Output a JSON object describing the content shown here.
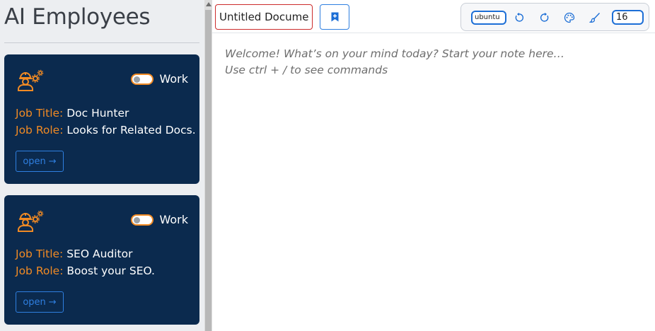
{
  "sidebar": {
    "title": "AI Employees",
    "cards": [
      {
        "icon": "worker-gear-icon",
        "toggle_label": "Work",
        "job_title_key": "Job Title:",
        "job_title_value": "Doc Hunter",
        "job_role_key": "Job Role:",
        "job_role_value": "Looks for Related Docs.",
        "open_label": "open",
        "open_arrow": "→"
      },
      {
        "icon": "worker-gear-icon",
        "toggle_label": "Work",
        "job_title_key": "Job Title:",
        "job_title_value": "SEO Auditor",
        "job_role_key": "Job Role:",
        "job_role_value": "Boost your SEO.",
        "open_label": "open",
        "open_arrow": "→"
      }
    ]
  },
  "toolbar": {
    "doc_title_value": "Untitled Document",
    "font_value": "ubuntu",
    "font_size_value": "16",
    "bookmark_icon": "bookmark-plus-icon",
    "undo_icon": "undo-icon",
    "redo_icon": "redo-icon",
    "palette_icon": "palette-icon",
    "brush_icon": "brush-icon"
  },
  "editor": {
    "placeholder_line1": "Welcome! What’s on your mind today? Start your note here…",
    "placeholder_line2": "Use ctrl + / to see commands"
  },
  "colors": {
    "card_bg": "#0b2a4e",
    "accent_orange": "#f08a24",
    "accent_blue": "#2f7fe0",
    "title_border": "#cc2b2b"
  }
}
